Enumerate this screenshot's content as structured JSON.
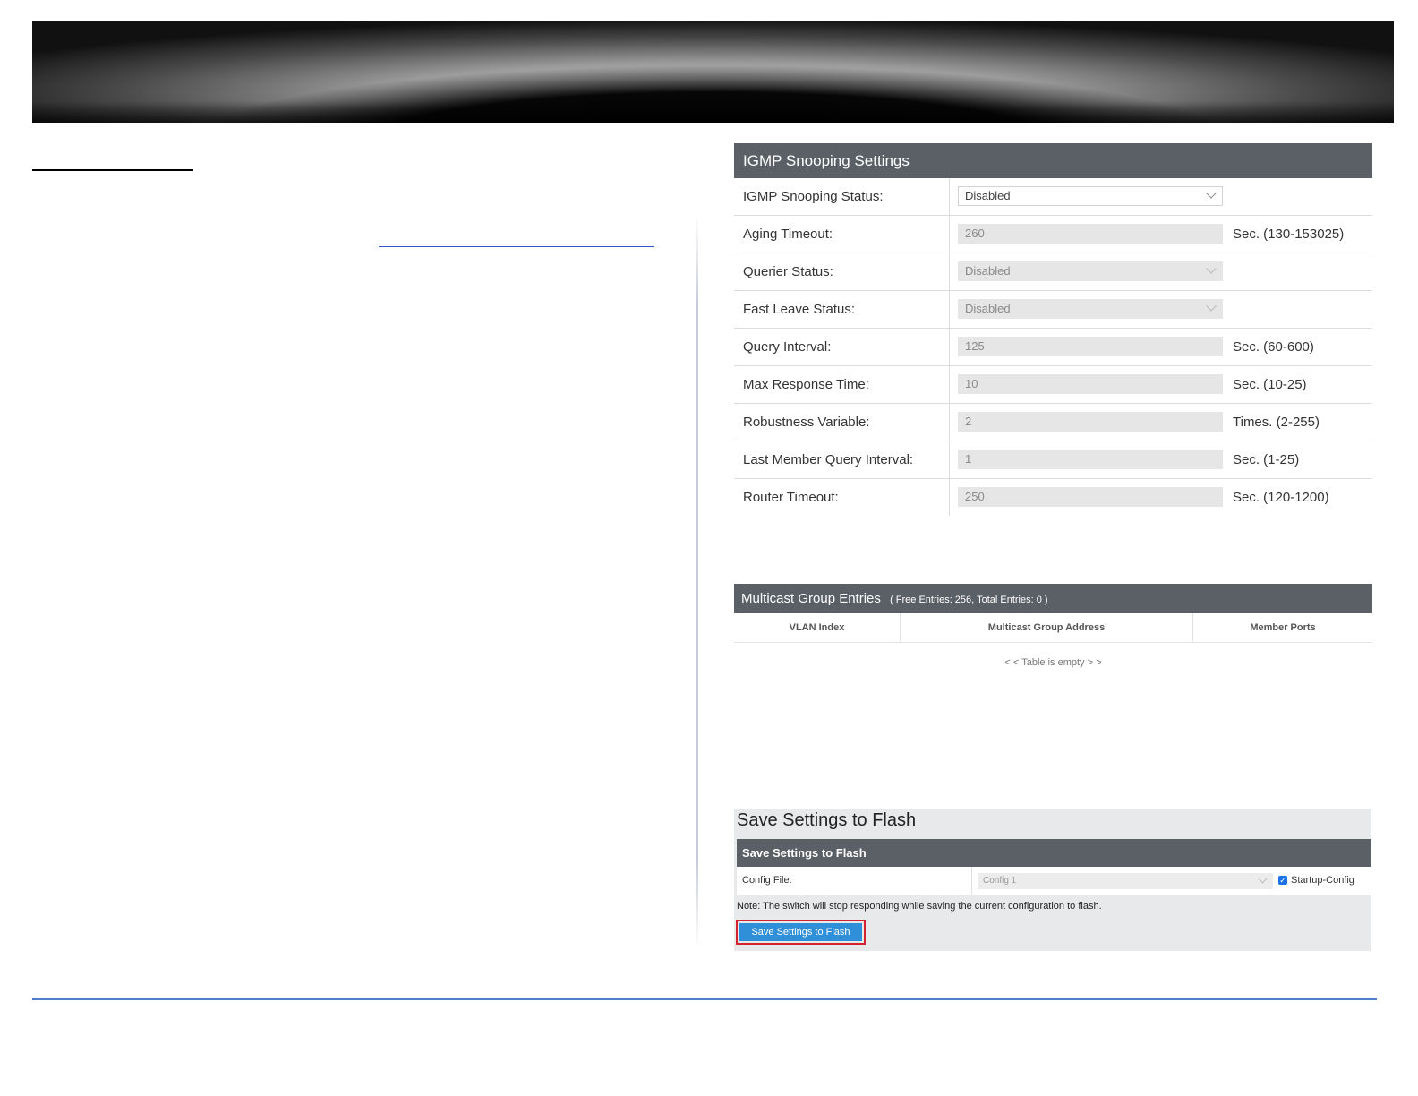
{
  "igmp": {
    "title": "IGMP Snooping Settings",
    "rows": [
      {
        "label": "IGMP Snooping Status:",
        "value": "Disabled",
        "type": "select",
        "hint": ""
      },
      {
        "label": "Aging Timeout:",
        "value": "260",
        "type": "input",
        "hint": "Sec. (130-153025)"
      },
      {
        "label": "Querier Status:",
        "value": "Disabled",
        "type": "select",
        "hint": ""
      },
      {
        "label": "Fast Leave Status:",
        "value": "Disabled",
        "type": "select",
        "hint": ""
      },
      {
        "label": "Query Interval:",
        "value": "125",
        "type": "input",
        "hint": "Sec. (60-600)"
      },
      {
        "label": "Max Response Time:",
        "value": "10",
        "type": "input",
        "hint": "Sec. (10-25)"
      },
      {
        "label": "Robustness Variable:",
        "value": "2",
        "type": "input",
        "hint": "Times. (2-255)"
      },
      {
        "label": "Last Member Query Interval:",
        "value": "1",
        "type": "input",
        "hint": "Sec. (1-25)"
      },
      {
        "label": "Router Timeout:",
        "value": "250",
        "type": "input",
        "hint": "Sec. (120-1200)"
      }
    ]
  },
  "multicast": {
    "title": "Multicast Group Entries",
    "subtitle": "( Free Entries: 256, Total Entries: 0 )",
    "columns": [
      "VLAN Index",
      "Multicast Group Address",
      "Member Ports"
    ],
    "empty_text": "< < Table is empty > >"
  },
  "save": {
    "page_title": "Save Settings to Flash",
    "header": "Save Settings to Flash",
    "config_label": "Config File:",
    "config_value": "Config 1",
    "startup_label": "Startup-Config",
    "startup_checked": true,
    "note": "Note: The switch will stop responding while saving the current configuration to flash.",
    "button_label": "Save Settings to Flash"
  },
  "colors": {
    "panel_header": "#5b5f66",
    "button": "#2f8fd8",
    "highlight_border": "#d3232f",
    "footer_line": "#4f7dd1"
  }
}
